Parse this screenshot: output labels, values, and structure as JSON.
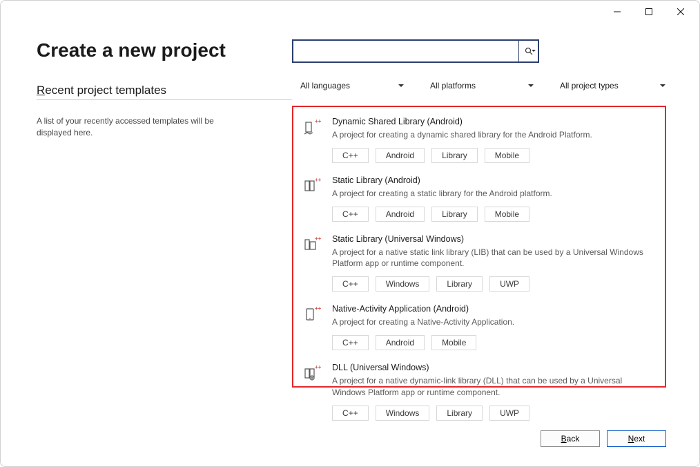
{
  "page_title": "Create a new project",
  "recent": {
    "header_pre": "R",
    "header_rest": "ecent project templates",
    "description": "A list of your recently accessed templates will be displayed here."
  },
  "search": {
    "value": "",
    "placeholder": ""
  },
  "filters": {
    "languages": "All languages",
    "platforms": "All platforms",
    "types": "All project types"
  },
  "templates": [
    {
      "title": "Dynamic Shared Library (Android)",
      "description": "A project for creating a dynamic shared library for the Android Platform.",
      "tags": [
        "C++",
        "Android",
        "Library",
        "Mobile"
      ],
      "icon": "lib-share-icon"
    },
    {
      "title": "Static Library (Android)",
      "description": "A project for creating a static library for the Android platform.",
      "tags": [
        "C++",
        "Android",
        "Library",
        "Mobile"
      ],
      "icon": "lib-static-icon"
    },
    {
      "title": "Static Library (Universal Windows)",
      "description": "A project for a native static link library (LIB) that can be used by a Universal Windows Platform app or runtime component.",
      "tags": [
        "C++",
        "Windows",
        "Library",
        "UWP"
      ],
      "icon": "lib-uwp-icon"
    },
    {
      "title": "Native-Activity Application (Android)",
      "description": "A project for creating a Native-Activity Application.",
      "tags": [
        "C++",
        "Android",
        "Mobile"
      ],
      "icon": "native-app-icon"
    },
    {
      "title": "DLL (Universal Windows)",
      "description": "A project for a native dynamic-link library (DLL) that can be used by a Universal Windows Platform app or runtime component.",
      "tags": [
        "C++",
        "Windows",
        "Library",
        "UWP"
      ],
      "icon": "dll-uwp-icon"
    }
  ],
  "footer": {
    "back_pre": "B",
    "back_rest": "ack",
    "next_pre": "N",
    "next_rest": "ext"
  }
}
